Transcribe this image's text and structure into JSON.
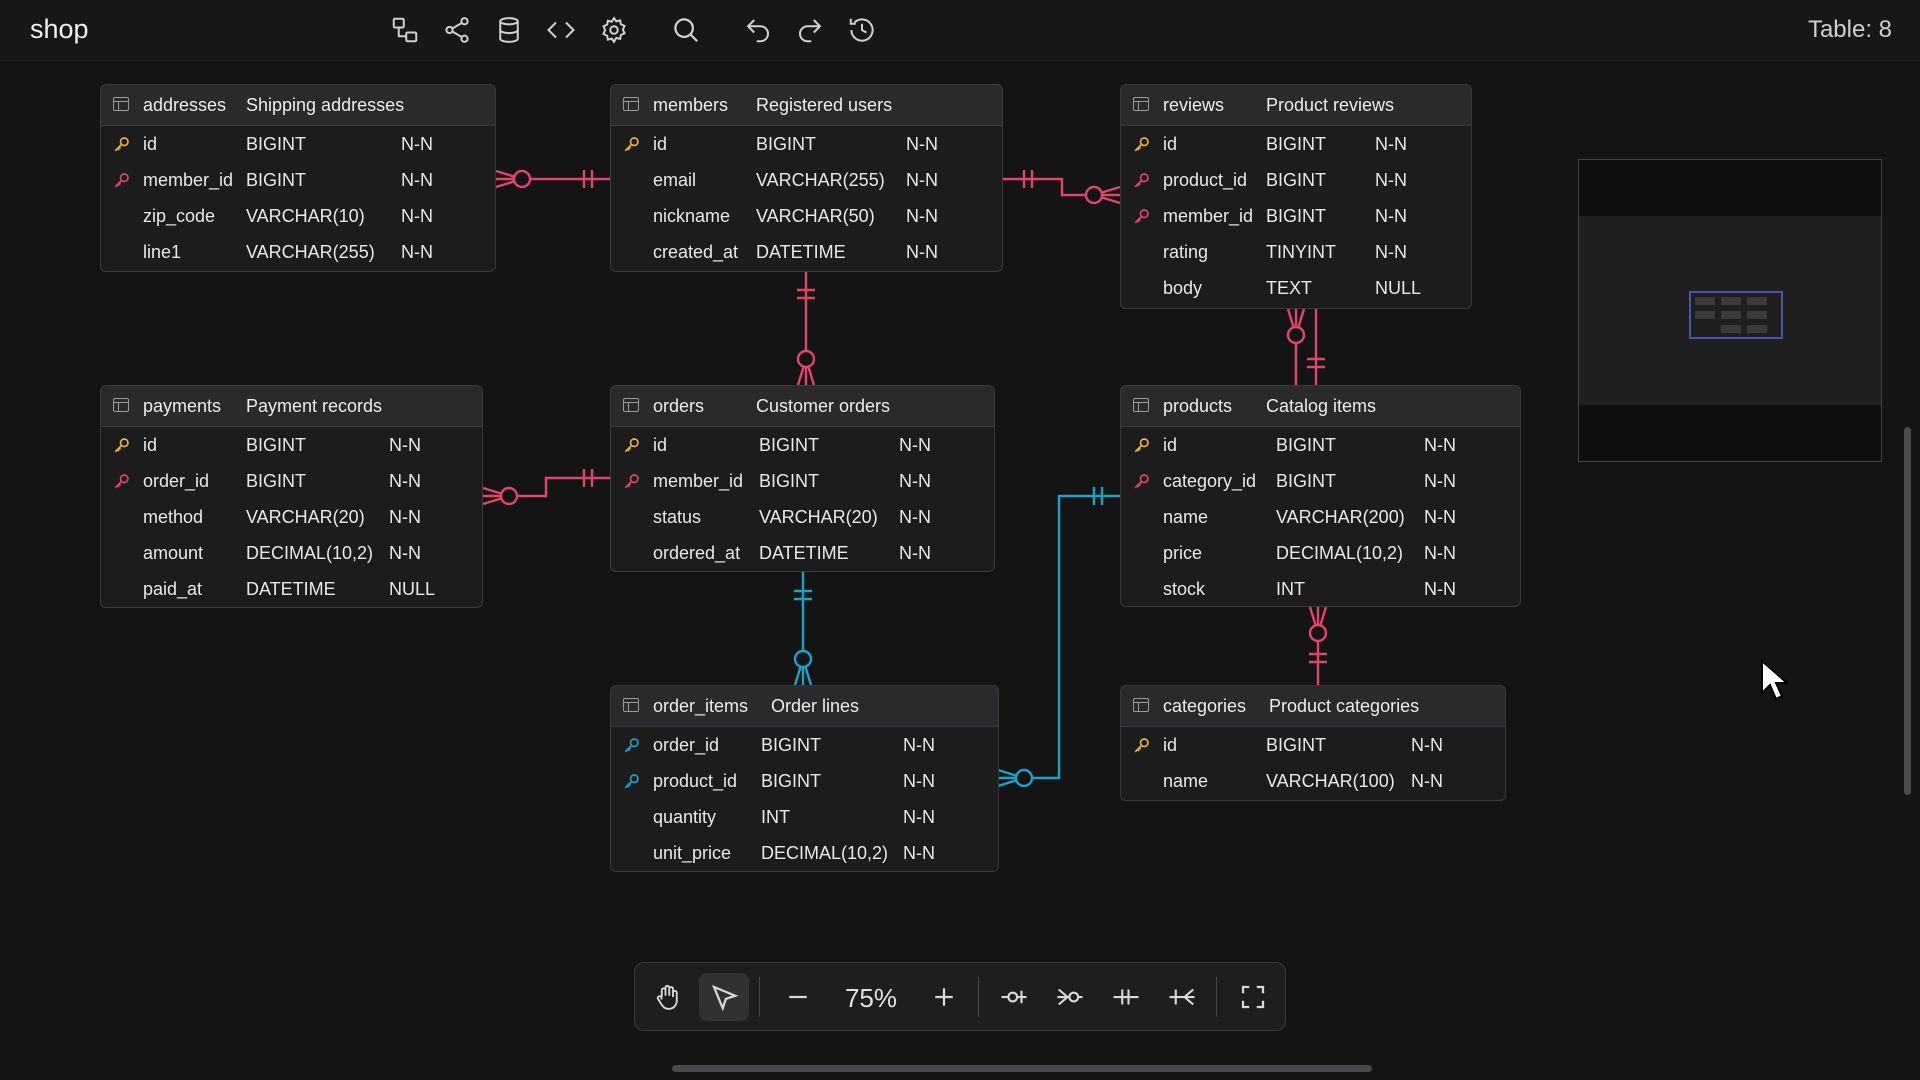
{
  "app": {
    "title": "shop",
    "table_count": "Table: 8"
  },
  "colors": {
    "pink": "#e0466a",
    "blue": "#1aa3c9",
    "pk_key": "#e8b341"
  },
  "toolbar": {
    "icons": [
      "diagram-icon",
      "share-icon",
      "database-icon",
      "code-icon",
      "gear-icon",
      "search-icon",
      "undo-icon",
      "redo-icon",
      "history-icon"
    ]
  },
  "entities": {
    "addresses": {
      "name": "addresses",
      "comment": "Shipping addresses",
      "columns": [
        {
          "name": "id",
          "type": "BIGINT",
          "null": "N-N",
          "key": "pk"
        },
        {
          "name": "member_id",
          "type": "BIGINT",
          "null": "N-N",
          "key": "fk-pink"
        },
        {
          "name": "zip_code",
          "type": "VARCHAR(10)",
          "null": "N-N",
          "key": ""
        },
        {
          "name": "line1",
          "type": "VARCHAR(255)",
          "null": "N-N",
          "key": ""
        }
      ]
    },
    "members": {
      "name": "members",
      "comment": "Registered users",
      "columns": [
        {
          "name": "id",
          "type": "BIGINT",
          "null": "N-N",
          "key": "pk"
        },
        {
          "name": "email",
          "type": "VARCHAR(255)",
          "null": "N-N",
          "key": ""
        },
        {
          "name": "nickname",
          "type": "VARCHAR(50)",
          "null": "N-N",
          "key": ""
        },
        {
          "name": "created_at",
          "type": "DATETIME",
          "null": "N-N",
          "key": ""
        }
      ]
    },
    "reviews": {
      "name": "reviews",
      "comment": "Product reviews",
      "columns": [
        {
          "name": "id",
          "type": "BIGINT",
          "null": "N-N",
          "key": "pk"
        },
        {
          "name": "product_id",
          "type": "BIGINT",
          "null": "N-N",
          "key": "fk-pink"
        },
        {
          "name": "member_id",
          "type": "BIGINT",
          "null": "N-N",
          "key": "fk-pink"
        },
        {
          "name": "rating",
          "type": "TINYINT",
          "null": "N-N",
          "key": ""
        },
        {
          "name": "body",
          "type": "TEXT",
          "null": "NULL",
          "key": ""
        }
      ]
    },
    "payments": {
      "name": "payments",
      "comment": "Payment records",
      "columns": [
        {
          "name": "id",
          "type": "BIGINT",
          "null": "N-N",
          "key": "pk"
        },
        {
          "name": "order_id",
          "type": "BIGINT",
          "null": "N-N",
          "key": "fk-pink"
        },
        {
          "name": "method",
          "type": "VARCHAR(20)",
          "null": "N-N",
          "key": ""
        },
        {
          "name": "amount",
          "type": "DECIMAL(10,2)",
          "null": "N-N",
          "key": ""
        },
        {
          "name": "paid_at",
          "type": "DATETIME",
          "null": "NULL",
          "key": ""
        }
      ]
    },
    "orders": {
      "name": "orders",
      "comment": "Customer orders",
      "columns": [
        {
          "name": "id",
          "type": "BIGINT",
          "null": "N-N",
          "key": "pk"
        },
        {
          "name": "member_id",
          "type": "BIGINT",
          "null": "N-N",
          "key": "fk-pink"
        },
        {
          "name": "status",
          "type": "VARCHAR(20)",
          "null": "N-N",
          "key": ""
        },
        {
          "name": "ordered_at",
          "type": "DATETIME",
          "null": "N-N",
          "key": ""
        }
      ]
    },
    "products": {
      "name": "products",
      "comment": "Catalog items",
      "columns": [
        {
          "name": "id",
          "type": "BIGINT",
          "null": "N-N",
          "key": "pk"
        },
        {
          "name": "category_id",
          "type": "BIGINT",
          "null": "N-N",
          "key": "fk-pink"
        },
        {
          "name": "name",
          "type": "VARCHAR(200)",
          "null": "N-N",
          "key": ""
        },
        {
          "name": "price",
          "type": "DECIMAL(10,2)",
          "null": "N-N",
          "key": ""
        },
        {
          "name": "stock",
          "type": "INT",
          "null": "N-N",
          "key": ""
        }
      ]
    },
    "order_items": {
      "name": "order_items",
      "comment": "Order lines",
      "columns": [
        {
          "name": "order_id",
          "type": "BIGINT",
          "null": "N-N",
          "key": "fk-blue"
        },
        {
          "name": "product_id",
          "type": "BIGINT",
          "null": "N-N",
          "key": "fk-blue"
        },
        {
          "name": "quantity",
          "type": "INT",
          "null": "N-N",
          "key": ""
        },
        {
          "name": "unit_price",
          "type": "DECIMAL(10,2)",
          "null": "N-N",
          "key": ""
        }
      ]
    },
    "categories": {
      "name": "categories",
      "comment": "Product categories",
      "columns": [
        {
          "name": "id",
          "type": "BIGINT",
          "null": "N-N",
          "key": "pk"
        },
        {
          "name": "name",
          "type": "VARCHAR(100)",
          "null": "N-N",
          "key": ""
        }
      ]
    }
  },
  "zoom": {
    "label": "75%"
  },
  "bottom_toolbar": {
    "icons": [
      "hand-icon",
      "pointer-icon",
      "zoom-out-icon",
      "zoom-in-icon",
      "zero-or-one-icon",
      "zero-or-many-icon",
      "exactly-one-icon",
      "one-or-many-icon",
      "fullscreen-icon"
    ]
  }
}
